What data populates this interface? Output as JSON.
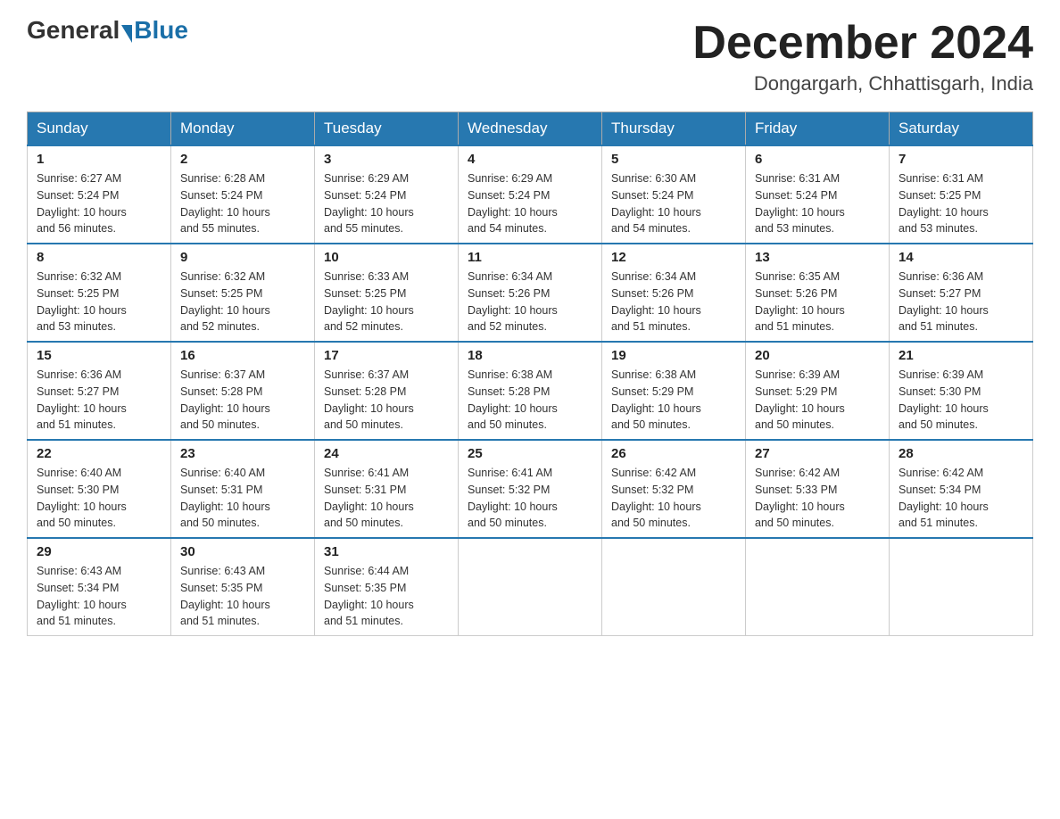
{
  "header": {
    "logo_general": "General",
    "logo_blue": "Blue",
    "title": "December 2024",
    "subtitle": "Dongargarh, Chhattisgarh, India"
  },
  "days_of_week": [
    "Sunday",
    "Monday",
    "Tuesday",
    "Wednesday",
    "Thursday",
    "Friday",
    "Saturday"
  ],
  "weeks": [
    [
      {
        "day": "1",
        "sunrise": "6:27 AM",
        "sunset": "5:24 PM",
        "daylight": "10 hours and 56 minutes."
      },
      {
        "day": "2",
        "sunrise": "6:28 AM",
        "sunset": "5:24 PM",
        "daylight": "10 hours and 55 minutes."
      },
      {
        "day": "3",
        "sunrise": "6:29 AM",
        "sunset": "5:24 PM",
        "daylight": "10 hours and 55 minutes."
      },
      {
        "day": "4",
        "sunrise": "6:29 AM",
        "sunset": "5:24 PM",
        "daylight": "10 hours and 54 minutes."
      },
      {
        "day": "5",
        "sunrise": "6:30 AM",
        "sunset": "5:24 PM",
        "daylight": "10 hours and 54 minutes."
      },
      {
        "day": "6",
        "sunrise": "6:31 AM",
        "sunset": "5:24 PM",
        "daylight": "10 hours and 53 minutes."
      },
      {
        "day": "7",
        "sunrise": "6:31 AM",
        "sunset": "5:25 PM",
        "daylight": "10 hours and 53 minutes."
      }
    ],
    [
      {
        "day": "8",
        "sunrise": "6:32 AM",
        "sunset": "5:25 PM",
        "daylight": "10 hours and 53 minutes."
      },
      {
        "day": "9",
        "sunrise": "6:32 AM",
        "sunset": "5:25 PM",
        "daylight": "10 hours and 52 minutes."
      },
      {
        "day": "10",
        "sunrise": "6:33 AM",
        "sunset": "5:25 PM",
        "daylight": "10 hours and 52 minutes."
      },
      {
        "day": "11",
        "sunrise": "6:34 AM",
        "sunset": "5:26 PM",
        "daylight": "10 hours and 52 minutes."
      },
      {
        "day": "12",
        "sunrise": "6:34 AM",
        "sunset": "5:26 PM",
        "daylight": "10 hours and 51 minutes."
      },
      {
        "day": "13",
        "sunrise": "6:35 AM",
        "sunset": "5:26 PM",
        "daylight": "10 hours and 51 minutes."
      },
      {
        "day": "14",
        "sunrise": "6:36 AM",
        "sunset": "5:27 PM",
        "daylight": "10 hours and 51 minutes."
      }
    ],
    [
      {
        "day": "15",
        "sunrise": "6:36 AM",
        "sunset": "5:27 PM",
        "daylight": "10 hours and 51 minutes."
      },
      {
        "day": "16",
        "sunrise": "6:37 AM",
        "sunset": "5:28 PM",
        "daylight": "10 hours and 50 minutes."
      },
      {
        "day": "17",
        "sunrise": "6:37 AM",
        "sunset": "5:28 PM",
        "daylight": "10 hours and 50 minutes."
      },
      {
        "day": "18",
        "sunrise": "6:38 AM",
        "sunset": "5:28 PM",
        "daylight": "10 hours and 50 minutes."
      },
      {
        "day": "19",
        "sunrise": "6:38 AM",
        "sunset": "5:29 PM",
        "daylight": "10 hours and 50 minutes."
      },
      {
        "day": "20",
        "sunrise": "6:39 AM",
        "sunset": "5:29 PM",
        "daylight": "10 hours and 50 minutes."
      },
      {
        "day": "21",
        "sunrise": "6:39 AM",
        "sunset": "5:30 PM",
        "daylight": "10 hours and 50 minutes."
      }
    ],
    [
      {
        "day": "22",
        "sunrise": "6:40 AM",
        "sunset": "5:30 PM",
        "daylight": "10 hours and 50 minutes."
      },
      {
        "day": "23",
        "sunrise": "6:40 AM",
        "sunset": "5:31 PM",
        "daylight": "10 hours and 50 minutes."
      },
      {
        "day": "24",
        "sunrise": "6:41 AM",
        "sunset": "5:31 PM",
        "daylight": "10 hours and 50 minutes."
      },
      {
        "day": "25",
        "sunrise": "6:41 AM",
        "sunset": "5:32 PM",
        "daylight": "10 hours and 50 minutes."
      },
      {
        "day": "26",
        "sunrise": "6:42 AM",
        "sunset": "5:32 PM",
        "daylight": "10 hours and 50 minutes."
      },
      {
        "day": "27",
        "sunrise": "6:42 AM",
        "sunset": "5:33 PM",
        "daylight": "10 hours and 50 minutes."
      },
      {
        "day": "28",
        "sunrise": "6:42 AM",
        "sunset": "5:34 PM",
        "daylight": "10 hours and 51 minutes."
      }
    ],
    [
      {
        "day": "29",
        "sunrise": "6:43 AM",
        "sunset": "5:34 PM",
        "daylight": "10 hours and 51 minutes."
      },
      {
        "day": "30",
        "sunrise": "6:43 AM",
        "sunset": "5:35 PM",
        "daylight": "10 hours and 51 minutes."
      },
      {
        "day": "31",
        "sunrise": "6:44 AM",
        "sunset": "5:35 PM",
        "daylight": "10 hours and 51 minutes."
      },
      null,
      null,
      null,
      null
    ]
  ],
  "labels": {
    "sunrise": "Sunrise:",
    "sunset": "Sunset:",
    "daylight": "Daylight:"
  }
}
